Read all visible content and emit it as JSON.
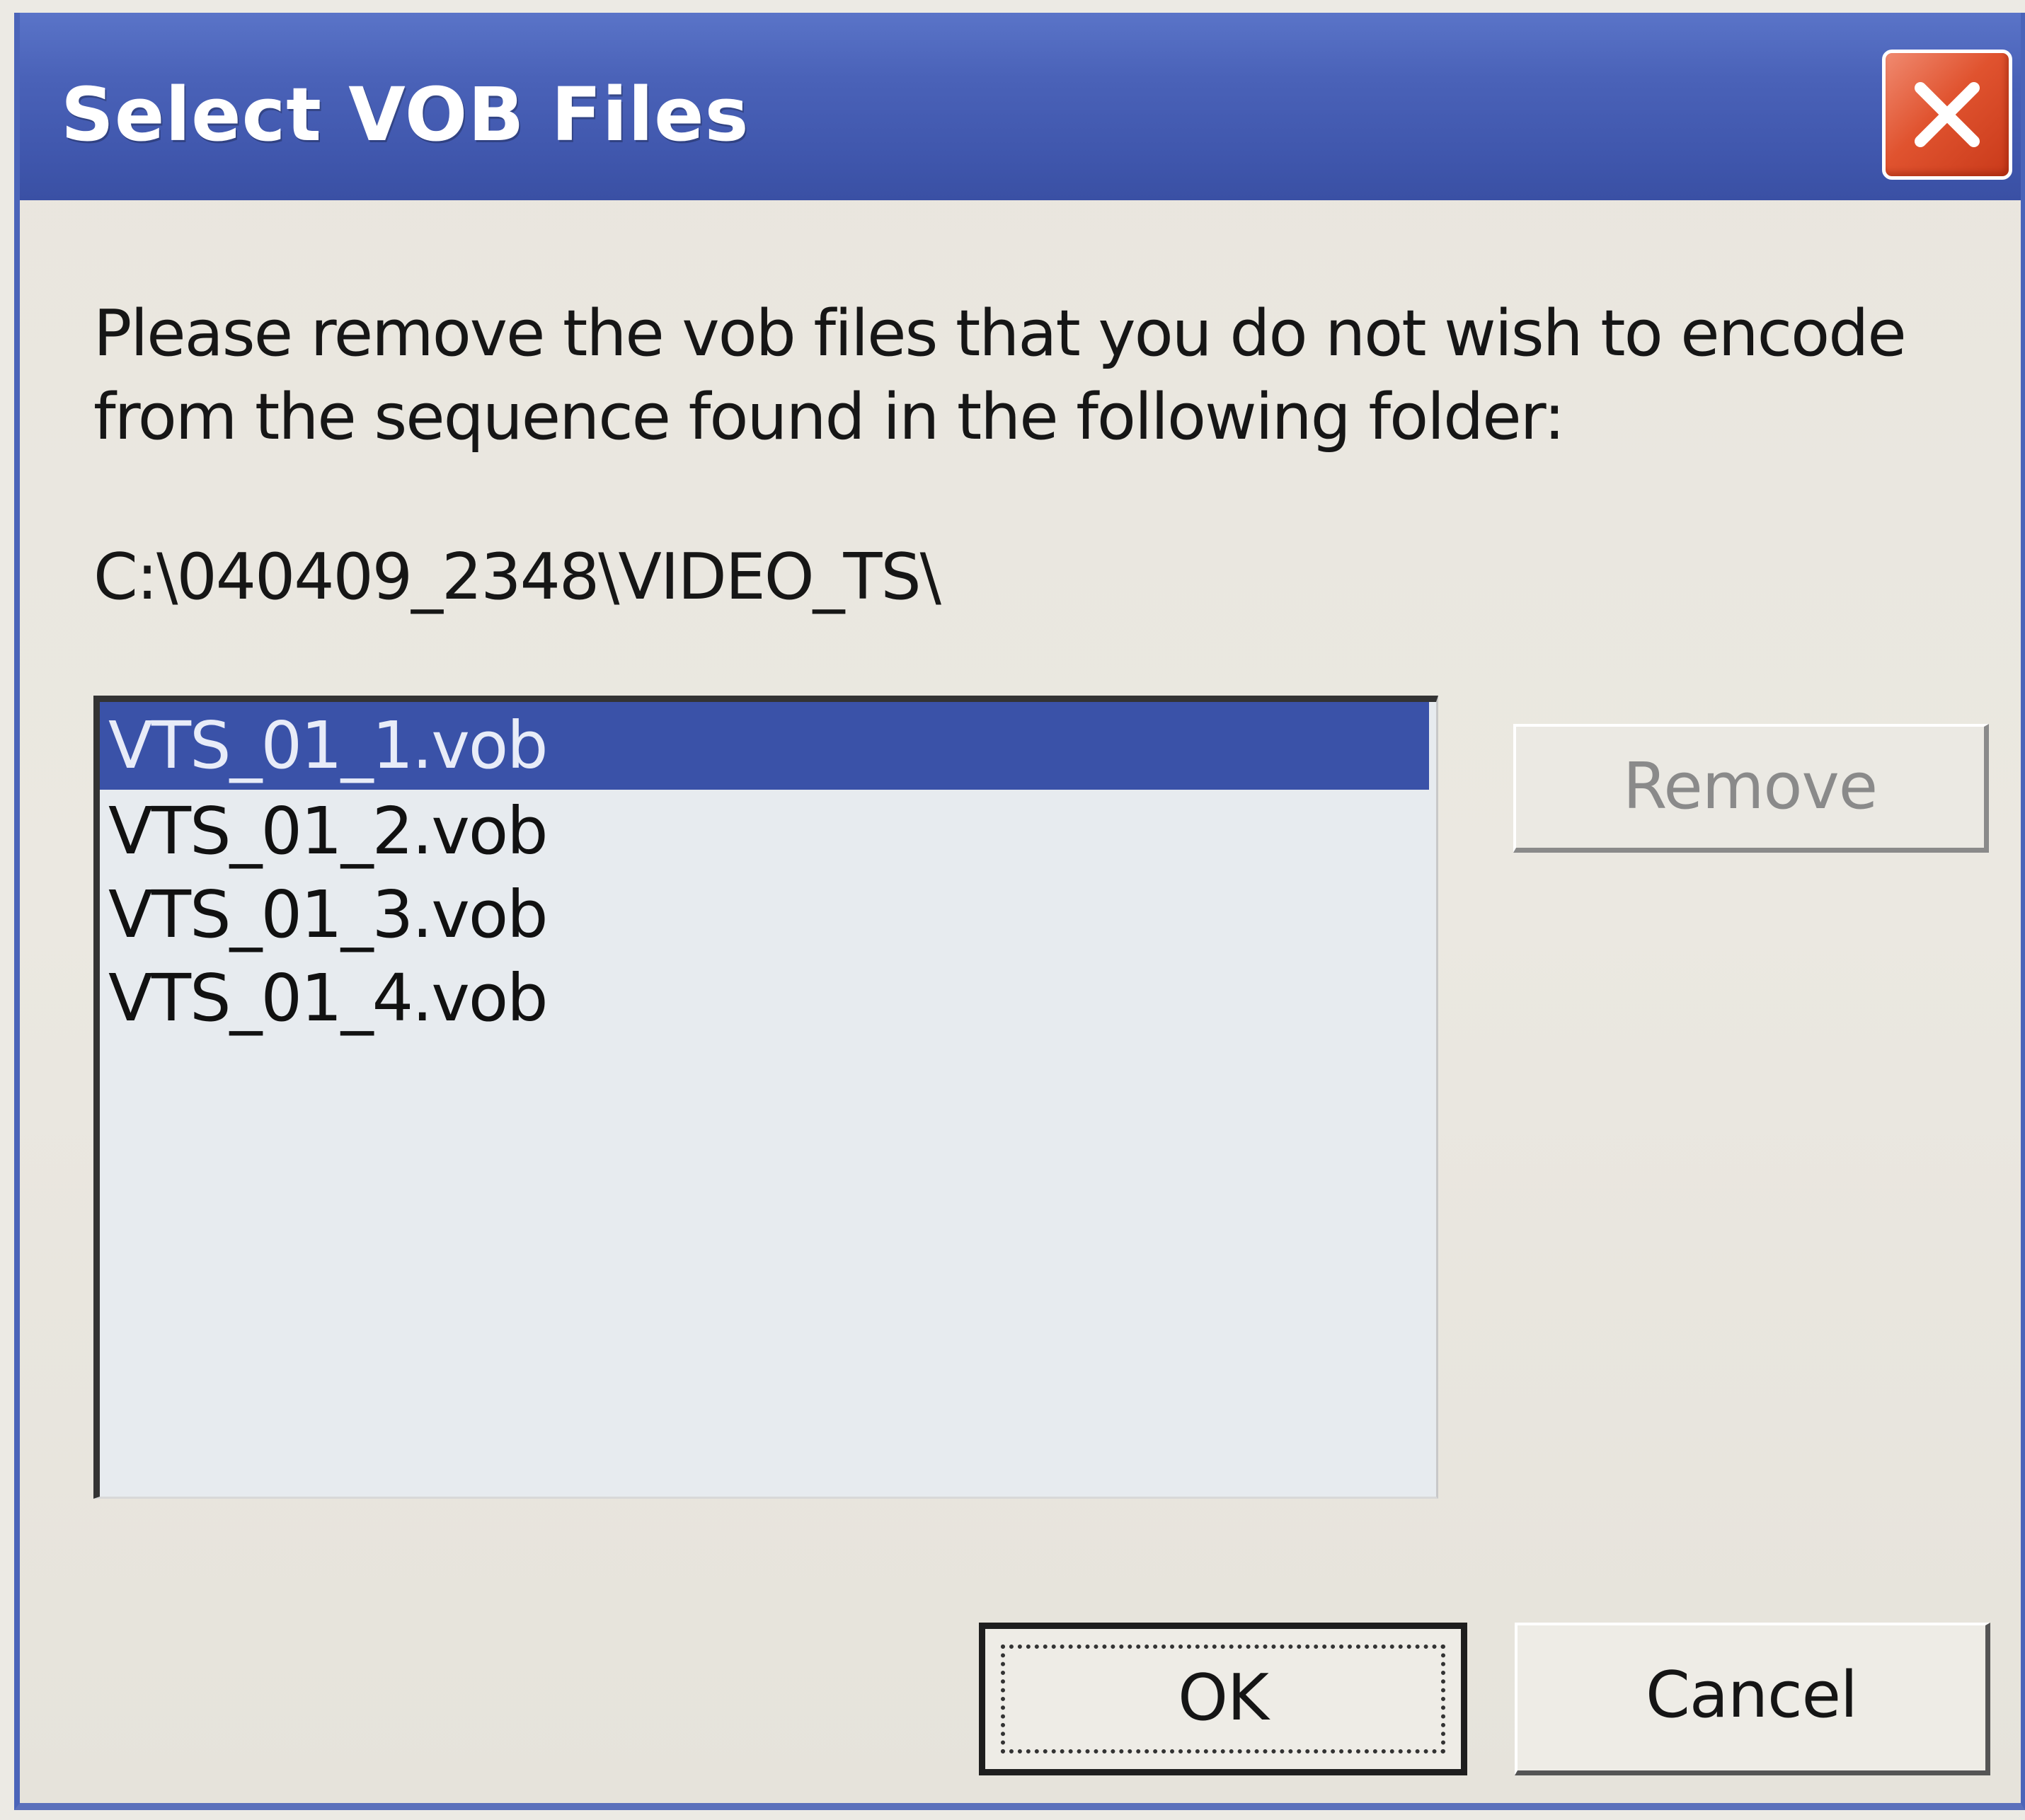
{
  "window": {
    "title": "Select VOB Files",
    "close_icon": "close-x-icon"
  },
  "dialog": {
    "message": "Please remove the vob files that you do not wish to encode from the sequence found in the following folder:",
    "folder_path": "C:\\040409_2348\\VIDEO_TS\\"
  },
  "file_list": {
    "items": [
      {
        "label": "VTS_01_1.vob",
        "selected": true
      },
      {
        "label": "VTS_01_2.vob",
        "selected": false
      },
      {
        "label": "VTS_01_3.vob",
        "selected": false
      },
      {
        "label": "VTS_01_4.vob",
        "selected": false
      }
    ]
  },
  "buttons": {
    "remove_label": "Remove",
    "ok_label": "OK",
    "cancel_label": "Cancel"
  },
  "colors": {
    "title_bar": "#4a62b8",
    "selection": "#3a52a8",
    "close_button": "#e0532f"
  }
}
